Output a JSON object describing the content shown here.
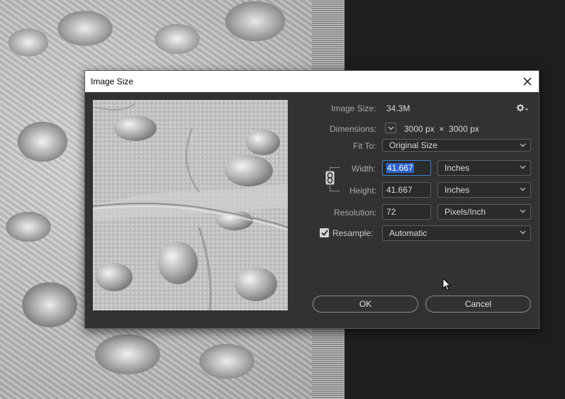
{
  "dialog": {
    "title": "Image Size",
    "close_glyph": "✕"
  },
  "info": {
    "image_size_label": "Image Size:",
    "image_size_value": "34.3M",
    "dimensions_label": "Dimensions:",
    "dimensions_value": "3000 px  ×  3000 px",
    "fit_to_label": "Fit To:",
    "fit_to_value": "Original Size"
  },
  "fields": {
    "width_label": "Width:",
    "width_value": "41.667",
    "width_unit": "Inches",
    "height_label": "Height:",
    "height_value": "41.667",
    "height_unit": "Inches",
    "resolution_label": "Resolution:",
    "resolution_value": "72",
    "resolution_unit": "Pixels/Inch",
    "resample_label": "Resample:",
    "resample_checked": true,
    "resample_value": "Automatic"
  },
  "buttons": {
    "ok_label": "OK",
    "cancel_label": "Cancel"
  },
  "icons": {
    "settings": "gear-icon",
    "dimensions_toggle": "chevron-down-icon",
    "constrain": "link-icon",
    "close": "close-icon",
    "pointer": "mouse-cursor-icon"
  },
  "colors": {
    "dialog_bg": "#323232",
    "selection": "#2d63c8",
    "focus_border": "#3f7fd1"
  }
}
